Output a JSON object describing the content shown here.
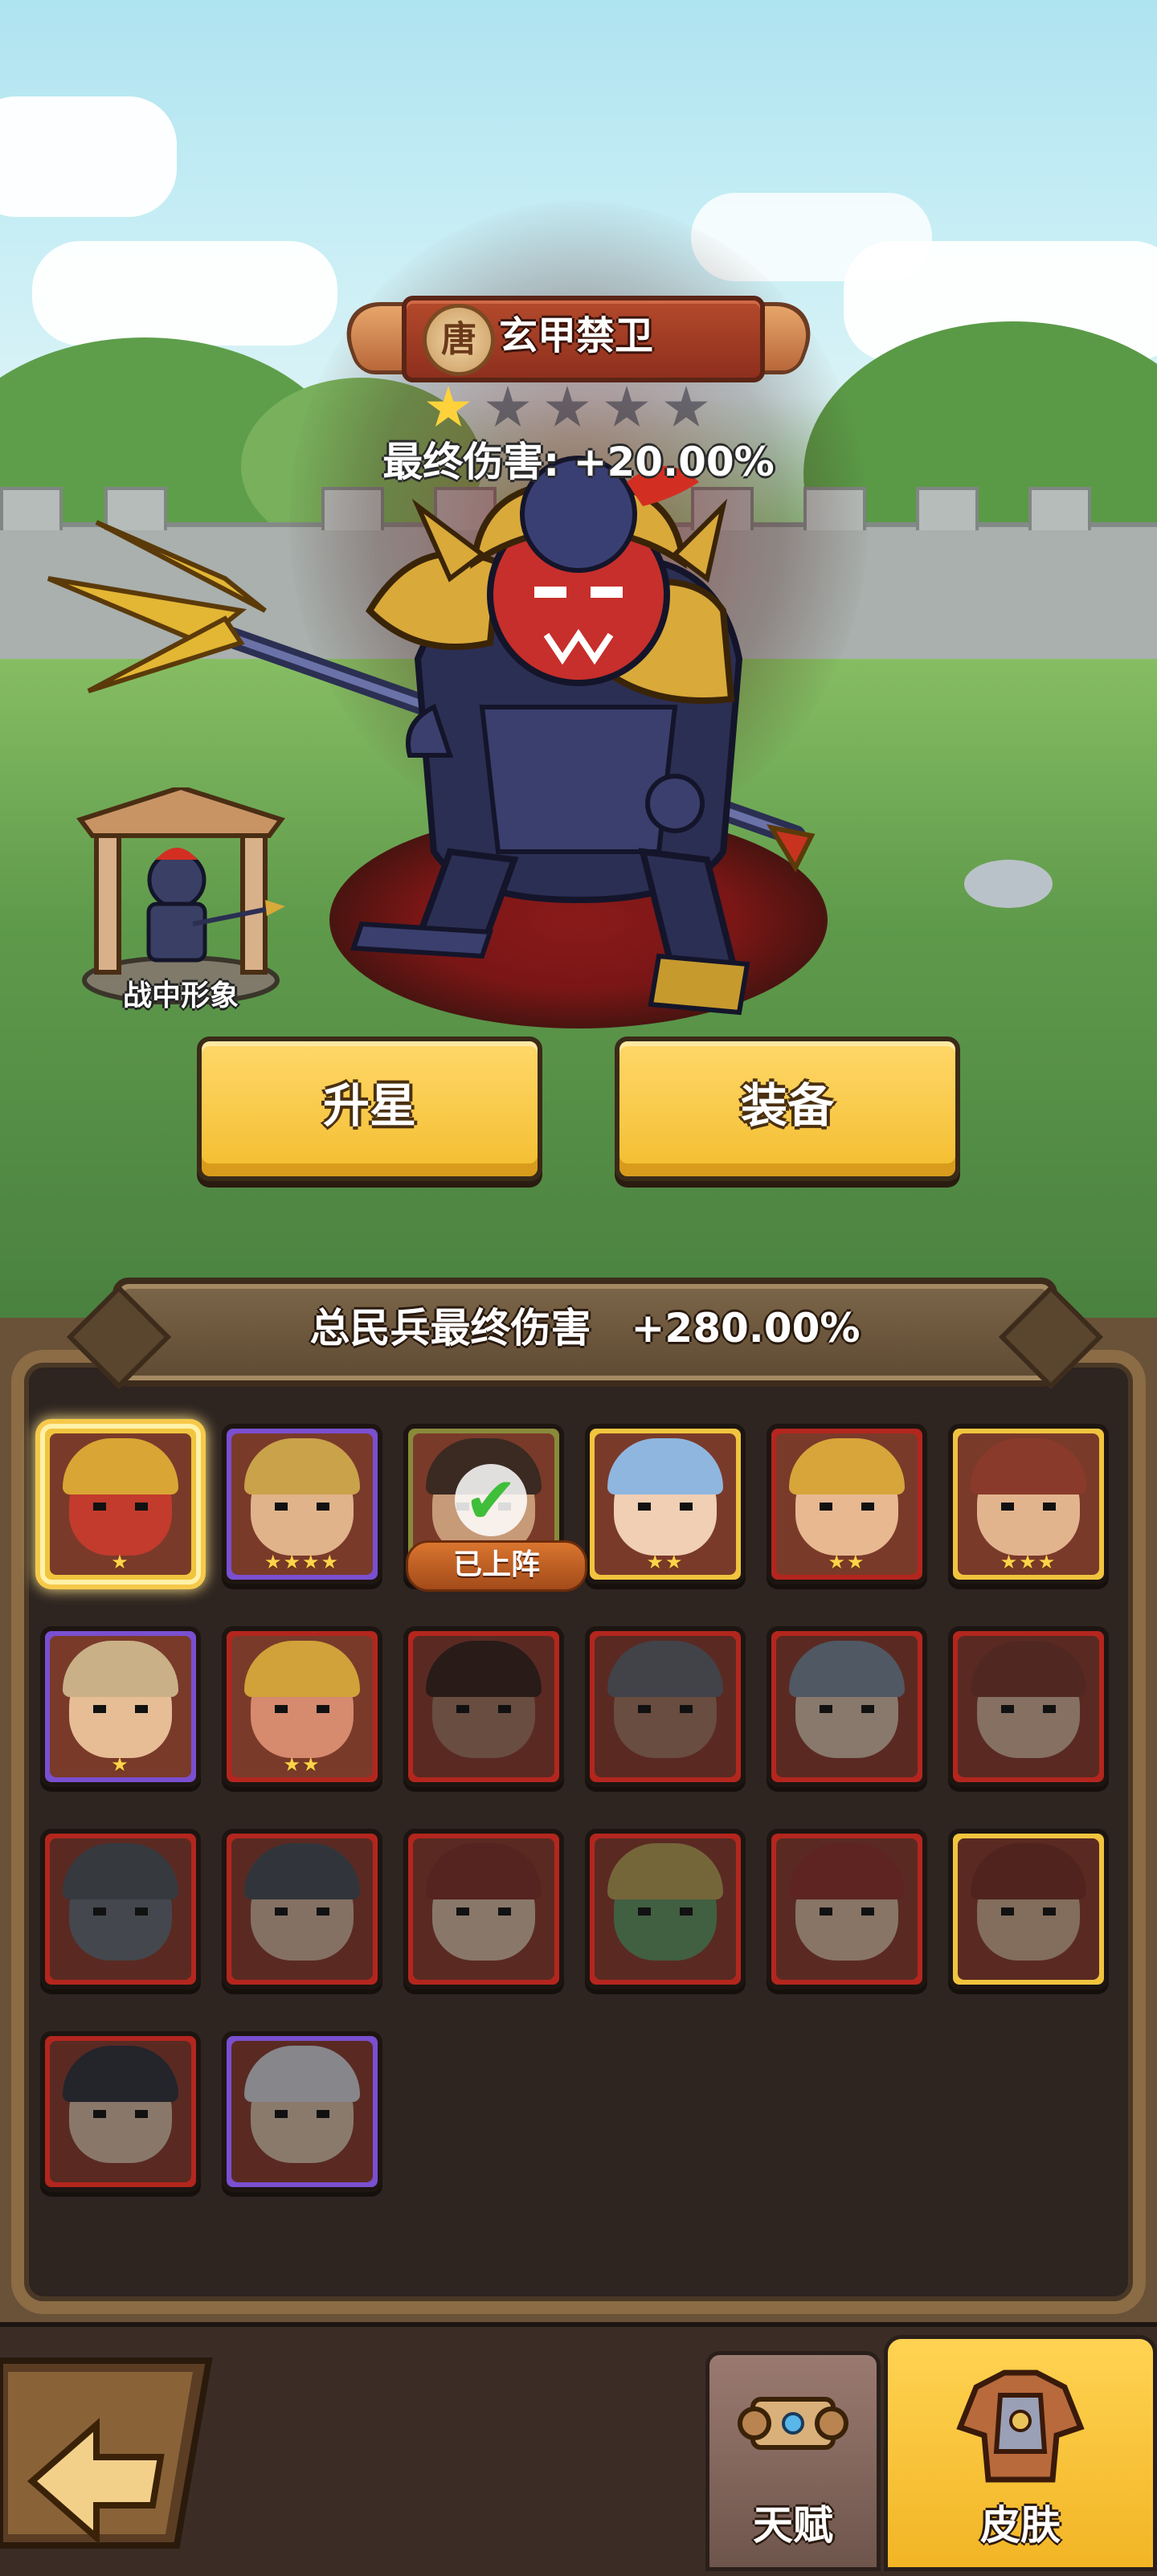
{
  "hero": {
    "faction_badge": "唐",
    "name": "玄甲禁卫",
    "stars_filled": 1,
    "stars_total": 5,
    "final_damage": "最终伤害: +20.00%"
  },
  "battle_image_label": "战中形象",
  "actions": {
    "star_up_label": "升星",
    "equip_label": "装备"
  },
  "summary": {
    "label": "总民兵最终伤害",
    "value": "+280.00%"
  },
  "skins": [
    {
      "frame": "gold",
      "stars": 1,
      "selected": true,
      "palette": [
        "#c23b2c",
        "#d9a534"
      ]
    },
    {
      "frame": "purple",
      "stars": 4,
      "palette": [
        "#e0b38a",
        "#c9a24a"
      ]
    },
    {
      "frame": "olive",
      "stars": 0,
      "deployed": true,
      "palette": [
        "#c79a78",
        "#3a2a22"
      ]
    },
    {
      "frame": "gold",
      "stars": 2,
      "palette": [
        "#f0cfb4",
        "#8fb6de"
      ]
    },
    {
      "frame": "red",
      "stars": 2,
      "palette": [
        "#e8b891",
        "#d7a53a"
      ]
    },
    {
      "frame": "gold",
      "stars": 3,
      "palette": [
        "#e2b48e",
        "#8a3a2a"
      ]
    },
    {
      "frame": "purple",
      "stars": 1,
      "palette": [
        "#e6bd95",
        "#c9b087"
      ]
    },
    {
      "frame": "red",
      "stars": 2,
      "palette": [
        "#d68a6e",
        "#d1a23a"
      ]
    },
    {
      "frame": "red",
      "stars": 0,
      "dim": true,
      "palette": [
        "#b8795a",
        "#4a2a22"
      ]
    },
    {
      "frame": "red",
      "stars": 0,
      "dim": true,
      "palette": [
        "#b8795a",
        "#6a6a7a"
      ]
    },
    {
      "frame": "red",
      "stars": 0,
      "dim": true,
      "palette": [
        "#e7c2a4",
        "#7a8fa8"
      ]
    },
    {
      "frame": "red",
      "stars": 0,
      "dim": true,
      "palette": [
        "#e2b291",
        "#9a3a2a"
      ]
    },
    {
      "frame": "red",
      "stars": 0,
      "dim": true,
      "palette": [
        "#6c7280",
        "#555c68"
      ]
    },
    {
      "frame": "red",
      "stars": 0,
      "dim": true,
      "palette": [
        "#e0b595",
        "#4c5664"
      ]
    },
    {
      "frame": "red",
      "stars": 0,
      "dim": true,
      "palette": [
        "#e7bf9d",
        "#a5312a"
      ]
    },
    {
      "frame": "red",
      "stars": 0,
      "dim": true,
      "palette": [
        "#5aa05a",
        "#c8a440"
      ]
    },
    {
      "frame": "red",
      "stars": 0,
      "dim": true,
      "palette": [
        "#e6bb97",
        "#b8322a"
      ]
    },
    {
      "frame": "gold",
      "stars": 0,
      "dim": true,
      "palette": [
        "#e0ad86",
        "#9a3226"
      ]
    },
    {
      "frame": "red",
      "stars": 0,
      "dim": true,
      "palette": [
        "#e7bf9d",
        "#3a3a4a"
      ]
    },
    {
      "frame": "purple",
      "stars": 0,
      "dim": true,
      "palette": [
        "#e6c3a3",
        "#d8d8e4"
      ]
    }
  ],
  "deployed_label": "已上阵",
  "nav": {
    "talent_label": "天赋",
    "skin_label": "皮肤"
  },
  "icons": {
    "back": "back-arrow-icon",
    "talent": "scroll-icon",
    "skin": "armor-icon",
    "star": "star-icon",
    "check": "check-icon"
  },
  "colors": {
    "button_yellow": "#f3bd2e",
    "frame_gold": "#f1c43e",
    "frame_purple": "#7a4fd0",
    "frame_red": "#b3261e",
    "frame_olive": "#8a8a3a",
    "tab_active": "#f2b525",
    "tab_inactive": "#7a5f55"
  }
}
